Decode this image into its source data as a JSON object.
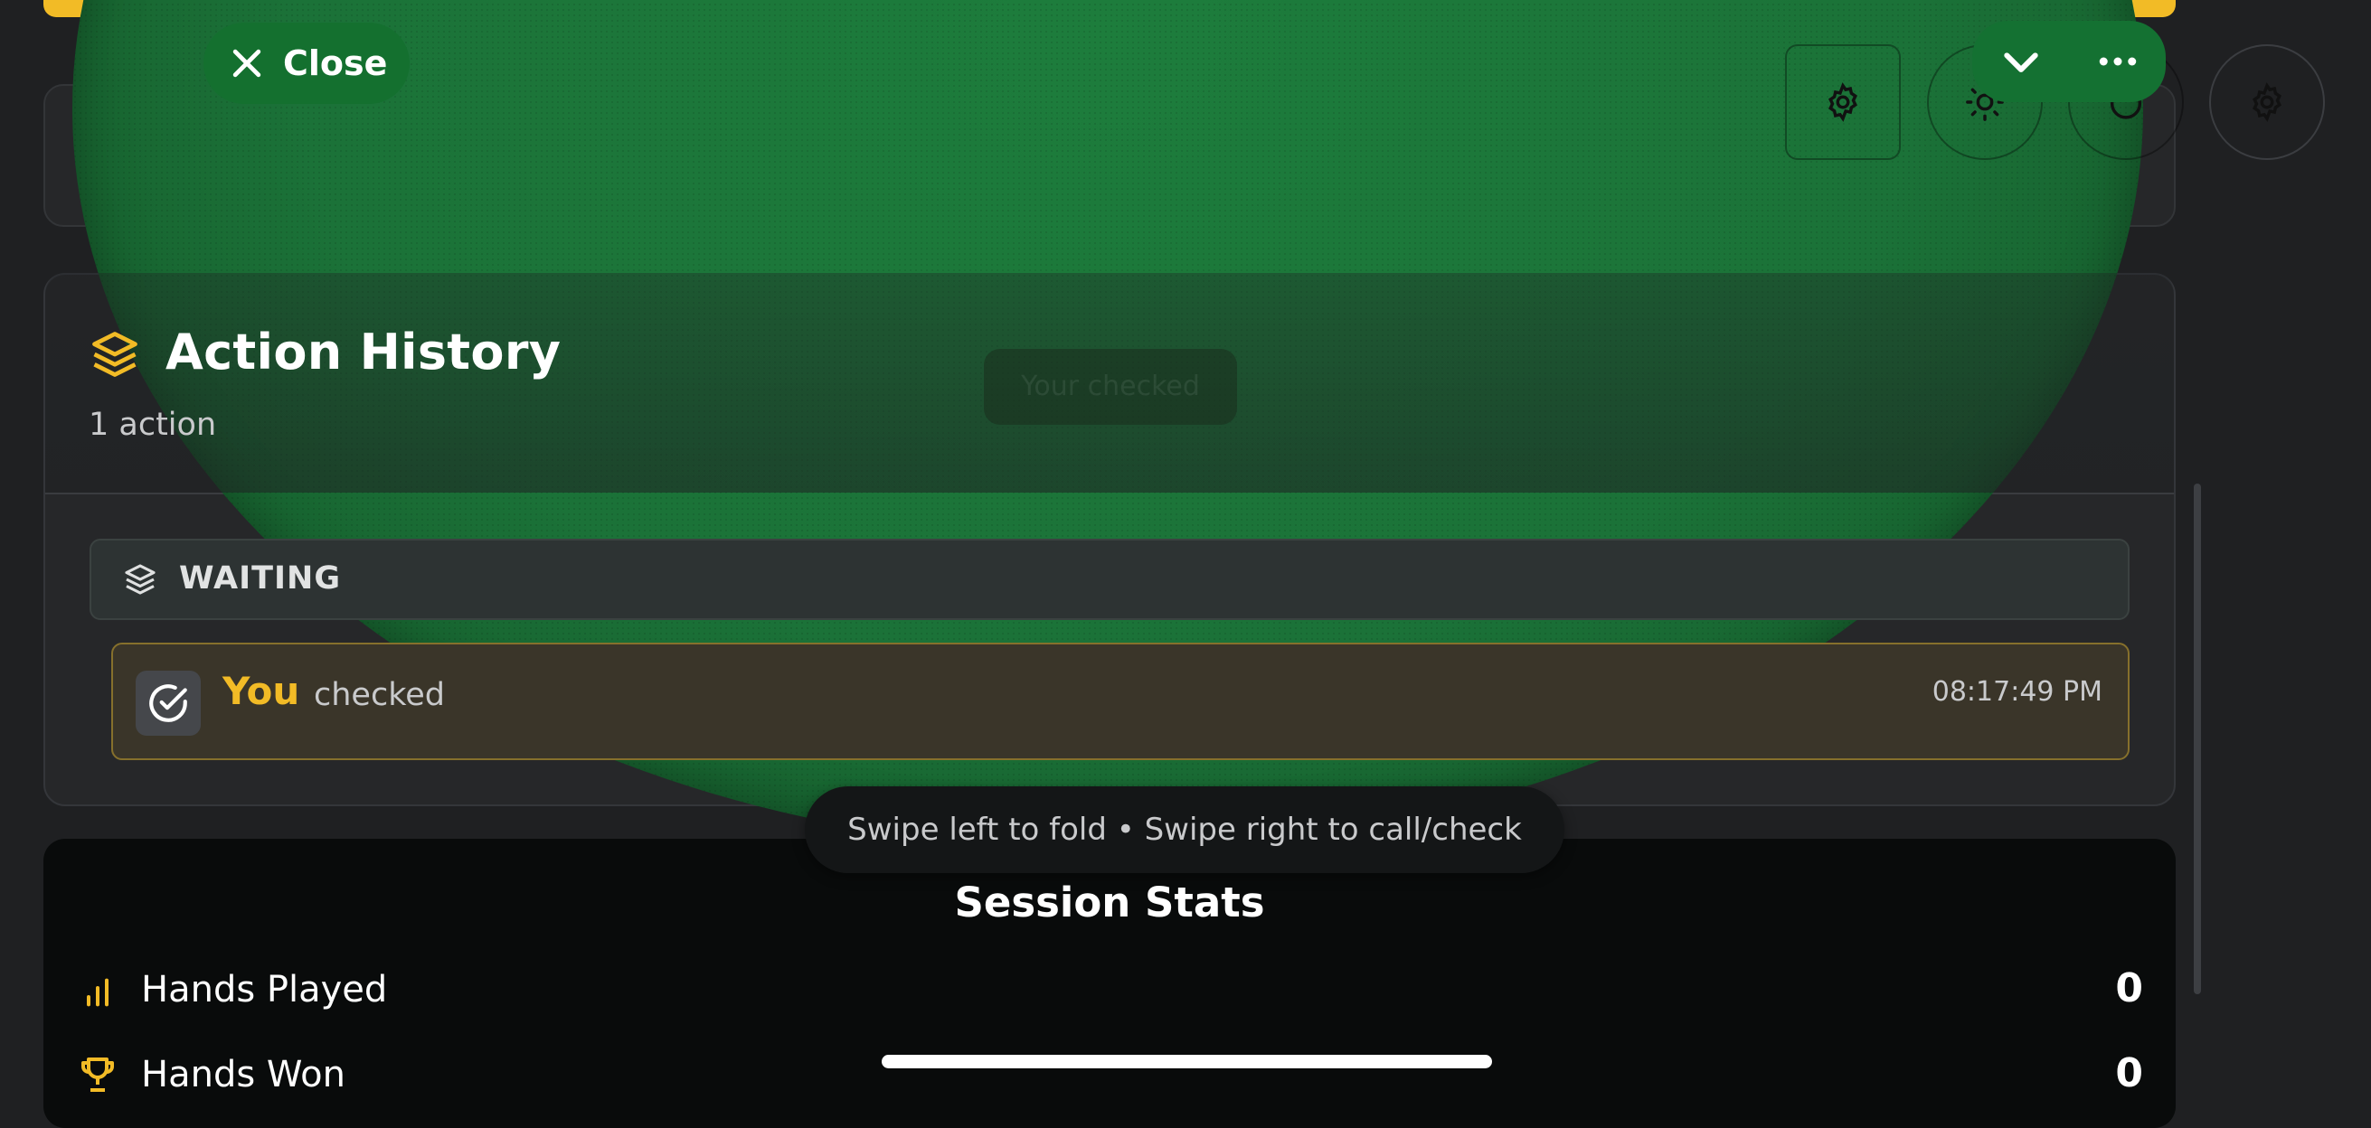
{
  "header": {
    "close_label": "Close"
  },
  "table": {
    "ghost_text": "Your checked"
  },
  "action_history": {
    "title": "Action History",
    "count": "1 action",
    "street": "WAITING",
    "actions": [
      {
        "player": "You",
        "verb": "checked",
        "time": "08:17:49 PM"
      }
    ]
  },
  "swipe_hint": "Swipe left to fold • Swipe right to call/check",
  "session_stats": {
    "title": "Session Stats",
    "rows": [
      {
        "label": "Hands Played",
        "value": "0"
      },
      {
        "label": "Hands Won",
        "value": "0"
      }
    ]
  },
  "colors": {
    "accent": "#f2bb26",
    "felt": "#1b7238",
    "background": "#1f2022"
  },
  "icons": [
    "close-icon",
    "gear-icon",
    "sun-icon",
    "power-icon",
    "chevron-down-icon",
    "more-icon",
    "layers-icon",
    "check-circle-icon",
    "bar-chart-icon",
    "trophy-icon",
    "chevron-up-icon"
  ]
}
